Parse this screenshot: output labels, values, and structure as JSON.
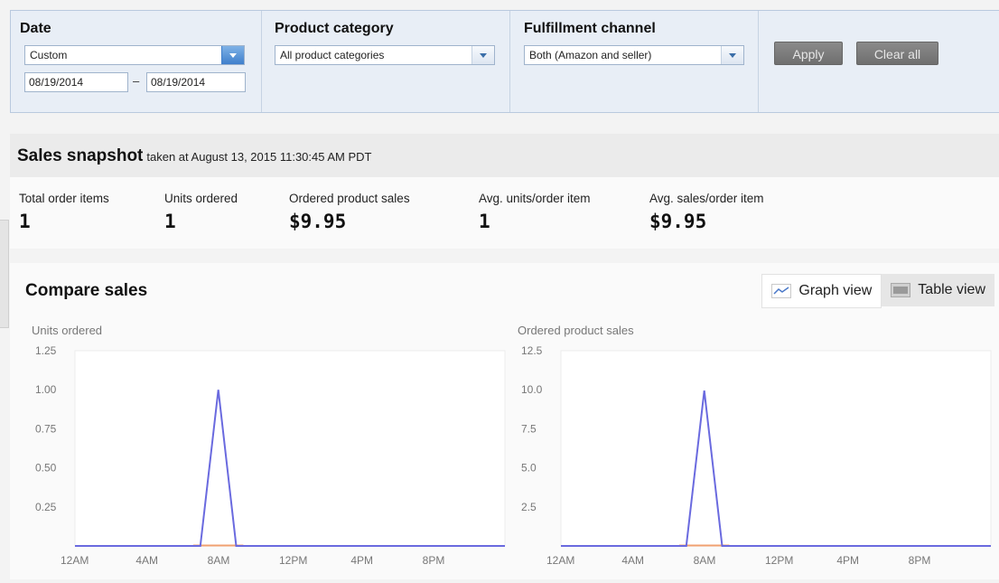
{
  "filters": {
    "date": {
      "label": "Date",
      "selected": "Custom",
      "from": "08/19/2014",
      "separator": "–",
      "to": "08/19/2014"
    },
    "category": {
      "label": "Product category",
      "selected": "All product categories"
    },
    "channel": {
      "label": "Fulfillment channel",
      "selected": "Both (Amazon and seller)"
    },
    "apply_label": "Apply",
    "clear_label": "Clear all"
  },
  "snapshot": {
    "title": "Sales snapshot",
    "taken_at": "taken at August 13, 2015 11:30:45 AM PDT",
    "metrics": [
      {
        "label": "Total order items",
        "value": "1"
      },
      {
        "label": "Units ordered",
        "value": "1"
      },
      {
        "label": "Ordered product sales",
        "value": "$9.95"
      },
      {
        "label": "Avg. units/order item",
        "value": "1"
      },
      {
        "label": "Avg. sales/order item",
        "value": "$9.95"
      }
    ]
  },
  "compare": {
    "title": "Compare sales",
    "graph_view_label": "Graph view",
    "table_view_label": "Table view",
    "graph_icon": "line-chart-icon",
    "table_icon": "table-icon"
  },
  "colors": {
    "series_primary": "#6a6adf",
    "series_secondary": "#f0a070",
    "accent_blue": "#3f7fcc"
  },
  "chart_data": [
    {
      "type": "line",
      "title": "Units ordered",
      "x": [
        "12AM",
        "4AM",
        "8AM",
        "12PM",
        "4PM",
        "8PM"
      ],
      "y_ticks": [
        "1.25",
        "1.00",
        "0.75",
        "0.50",
        "0.25"
      ],
      "ylim": [
        0,
        1.25
      ],
      "series": [
        {
          "values": [
            [
              0,
              0
            ],
            [
              7,
              0
            ],
            [
              8,
              1
            ],
            [
              9,
              0
            ],
            [
              24,
              0
            ]
          ]
        }
      ]
    },
    {
      "type": "line",
      "title": "Ordered product sales",
      "x": [
        "12AM",
        "4AM",
        "8AM",
        "12PM",
        "4PM",
        "8PM"
      ],
      "y_ticks": [
        "12.5",
        "10.0",
        "7.5",
        "5.0",
        "2.5"
      ],
      "ylim": [
        0,
        12.5
      ],
      "series": [
        {
          "values": [
            [
              0,
              0
            ],
            [
              7,
              0
            ],
            [
              8,
              9.95
            ],
            [
              9,
              0
            ],
            [
              24,
              0
            ]
          ]
        }
      ]
    }
  ]
}
